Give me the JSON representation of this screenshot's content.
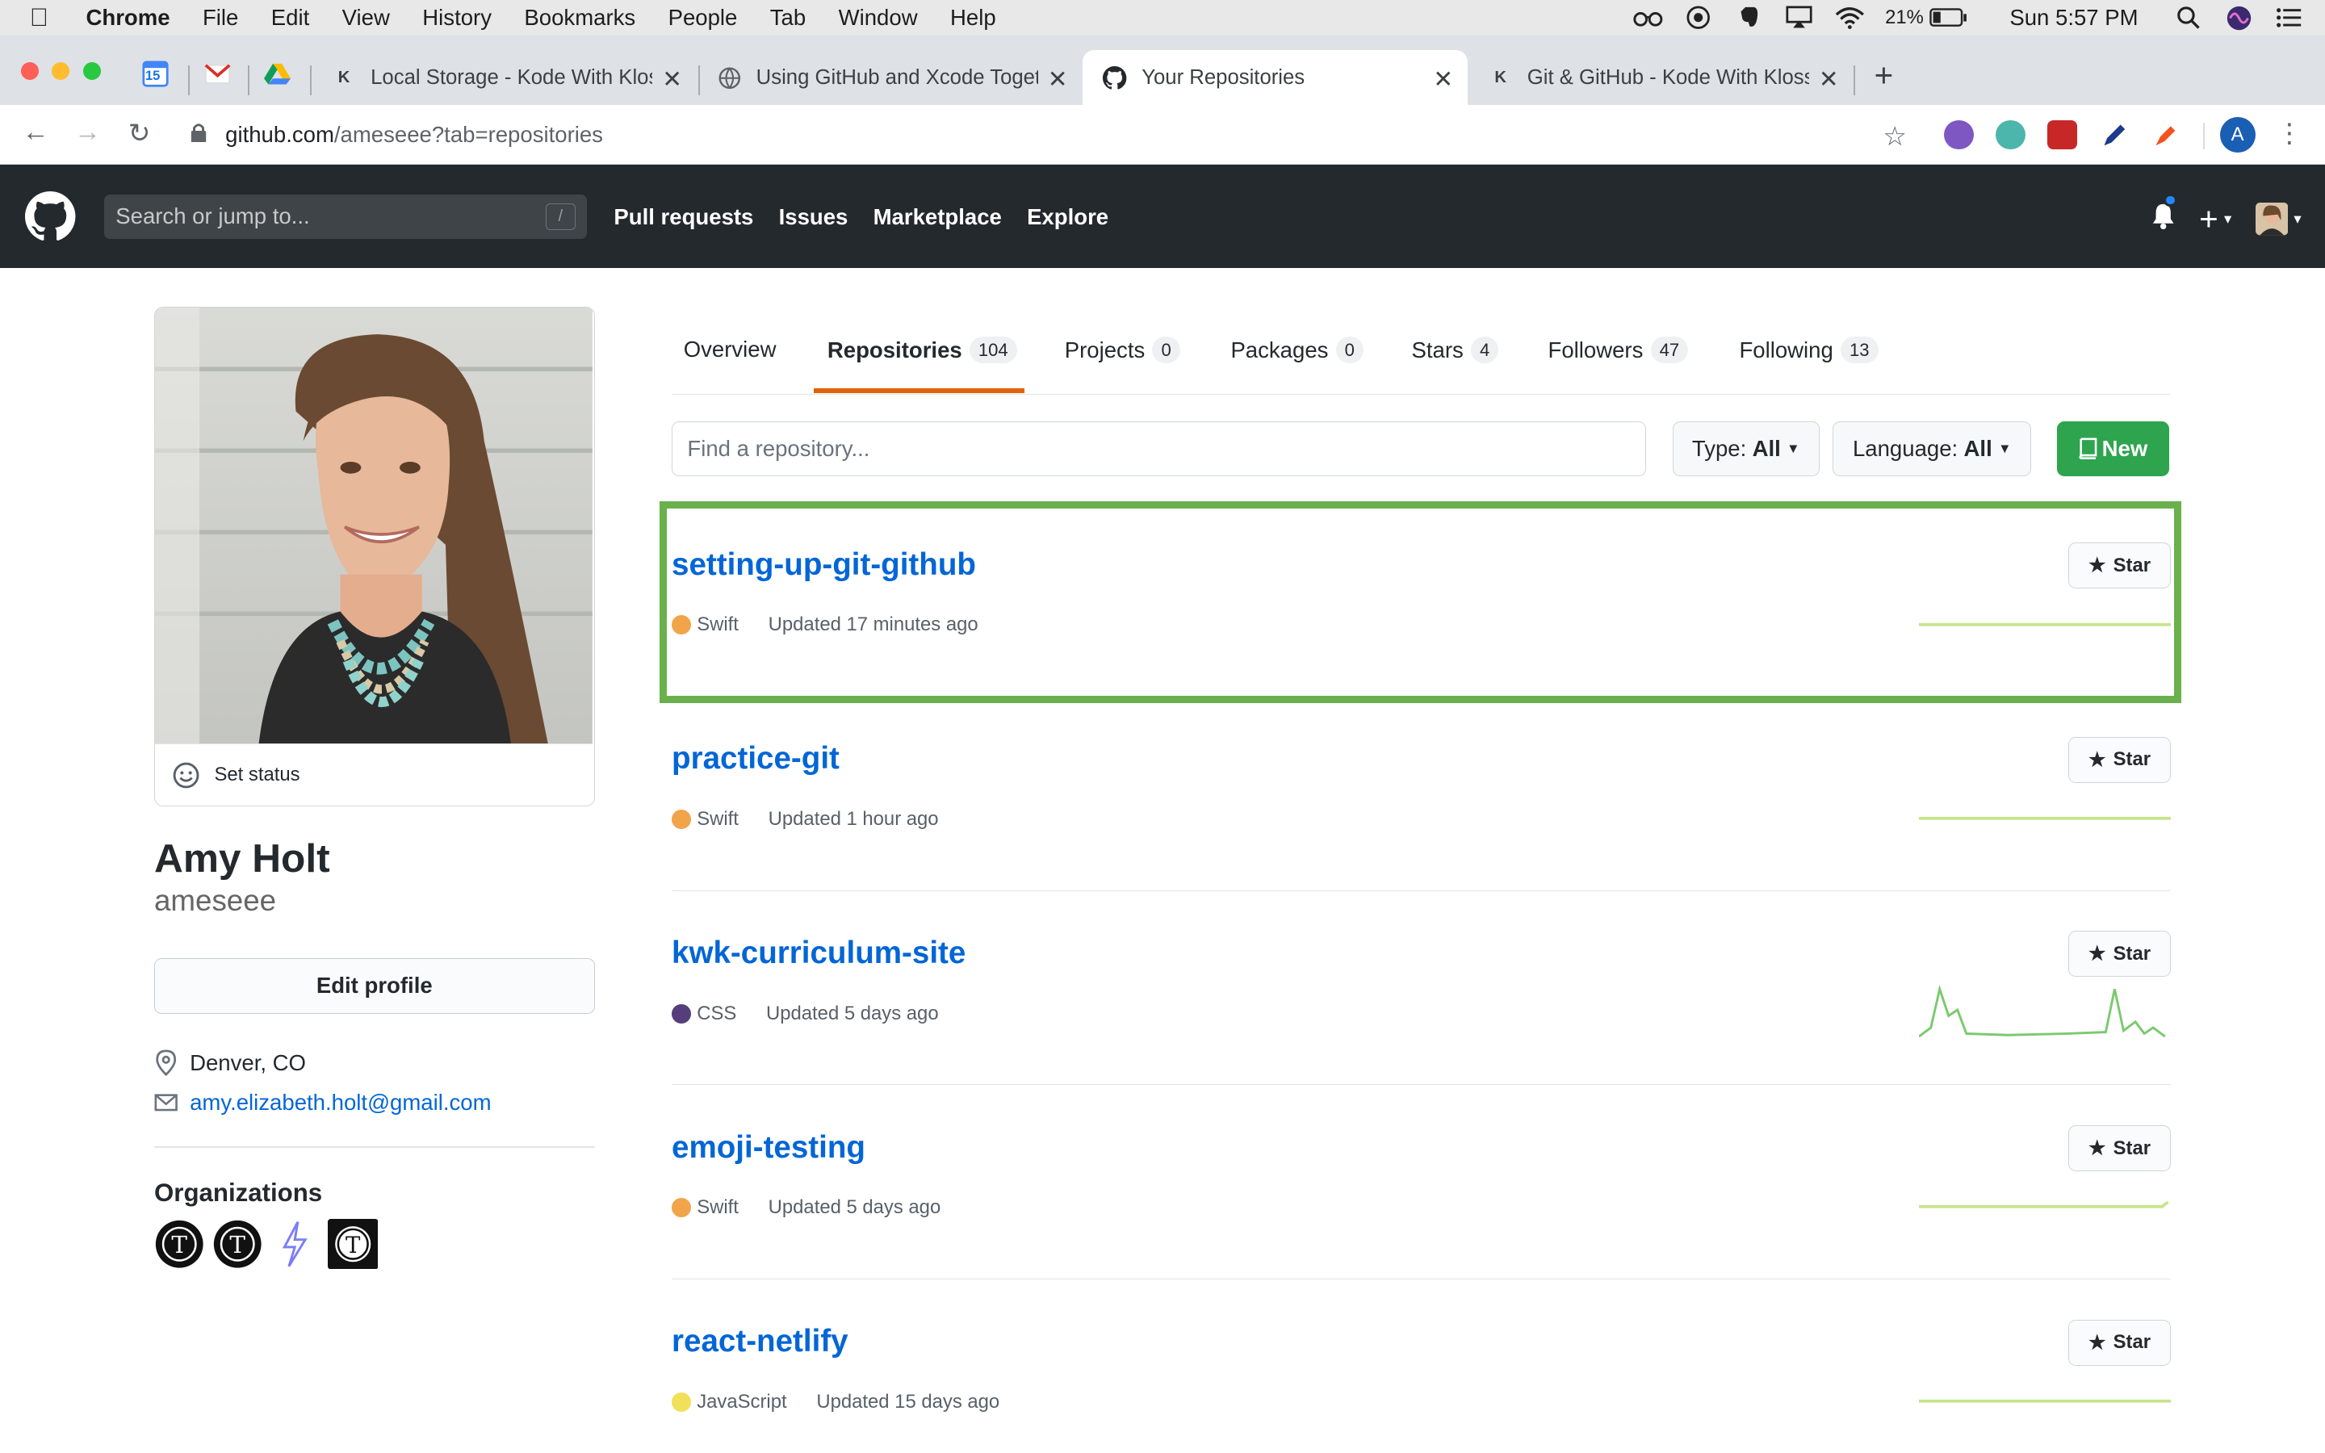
{
  "menubar": {
    "app": "Chrome",
    "items": [
      "File",
      "Edit",
      "View",
      "History",
      "Bookmarks",
      "People",
      "Tab",
      "Window",
      "Help"
    ],
    "battery": "21%",
    "clock": "Sun 5:57 PM"
  },
  "browser": {
    "tabs": [
      {
        "title": "Local Storage - Kode With Klossy"
      },
      {
        "title": "Using GitHub and Xcode Together"
      },
      {
        "title": "Your Repositories"
      },
      {
        "title": "Git & GitHub - Kode With Klossy"
      }
    ],
    "pinned_calendar": "15",
    "url_host": "github.com",
    "url_path": "/ameseee?tab=repositories",
    "profile_initial": "A"
  },
  "github": {
    "search_placeholder": "Search or jump to...",
    "slash_hint": "/",
    "nav": [
      "Pull requests",
      "Issues",
      "Marketplace",
      "Explore"
    ]
  },
  "profile": {
    "set_status": "Set status",
    "full_name": "Amy Holt",
    "username": "ameseee",
    "edit_label": "Edit profile",
    "location": "Denver, CO",
    "email": "amy.elizabeth.holt@gmail.com",
    "orgs_title": "Organizations"
  },
  "tabs": {
    "overview": "Overview",
    "repositories": "Repositories",
    "repositories_count": "104",
    "projects": "Projects",
    "projects_count": "0",
    "packages": "Packages",
    "packages_count": "0",
    "stars": "Stars",
    "stars_count": "4",
    "followers": "Followers",
    "followers_count": "47",
    "following": "Following",
    "following_count": "13"
  },
  "filters": {
    "find_placeholder": "Find a repository...",
    "type_label": "Type:",
    "type_value": "All",
    "language_label": "Language:",
    "language_value": "All",
    "new_label": "New"
  },
  "repos": [
    {
      "name": "setting-up-git-github",
      "language": "Swift",
      "lang_color": "#f1a44a",
      "updated": "Updated 17 minutes ago",
      "star": "Star"
    },
    {
      "name": "practice-git",
      "language": "Swift",
      "lang_color": "#f1a44a",
      "updated": "Updated 1 hour ago",
      "star": "Star"
    },
    {
      "name": "kwk-curriculum-site",
      "language": "CSS",
      "lang_color": "#563d7c",
      "updated": "Updated 5 days ago",
      "star": "Star"
    },
    {
      "name": "emoji-testing",
      "language": "Swift",
      "lang_color": "#f1a44a",
      "updated": "Updated 5 days ago",
      "star": "Star"
    },
    {
      "name": "react-netlify",
      "language": "JavaScript",
      "lang_color": "#f1e05a",
      "updated": "Updated 15 days ago",
      "star": "Star"
    }
  ]
}
